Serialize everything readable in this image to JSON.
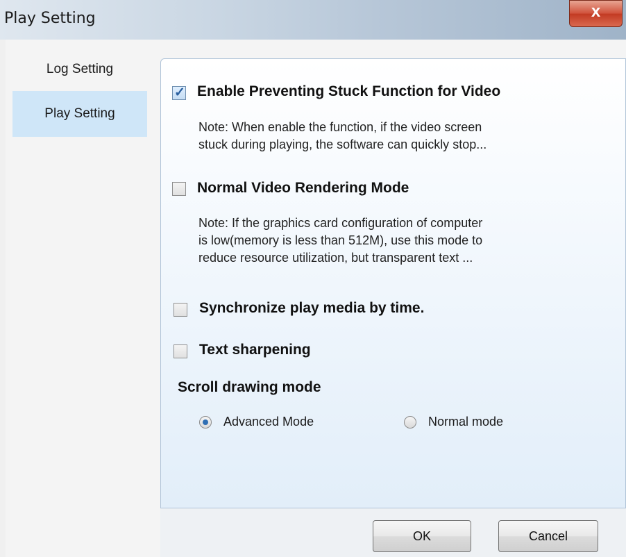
{
  "window": {
    "title": "Play Setting",
    "close_label": "x"
  },
  "nav": {
    "items": [
      {
        "label": "Log Setting",
        "active": false
      },
      {
        "label": "Play Setting",
        "active": true
      }
    ]
  },
  "options": {
    "preventing_stuck": {
      "label": "Enable Preventing Stuck Function for Video",
      "checked": true,
      "note": [
        "Note: When enable the function, if the video screen",
        "stuck during playing, the software can quickly stop..."
      ]
    },
    "normal_rendering": {
      "label": "Normal Video Rendering Mode",
      "checked": false,
      "note": [
        "Note: If the graphics card configuration of computer",
        "is low(memory is less than 512M), use this mode to",
        "reduce resource utilization, but transparent text ..."
      ]
    },
    "sync_by_time": {
      "label": "Synchronize play media by time.",
      "checked": false
    },
    "text_sharpening": {
      "label": "Text sharpening",
      "checked": false
    }
  },
  "scroll_mode": {
    "heading": "Scroll drawing mode",
    "options": [
      {
        "label": "Advanced Mode",
        "selected": true
      },
      {
        "label": "Normal mode",
        "selected": false
      }
    ]
  },
  "footer": {
    "ok_label": "OK",
    "cancel_label": "Cancel"
  },
  "colors": {
    "accent": "#2f6fb4",
    "nav_active": "#cfe6f8",
    "close": "#c23a22"
  }
}
